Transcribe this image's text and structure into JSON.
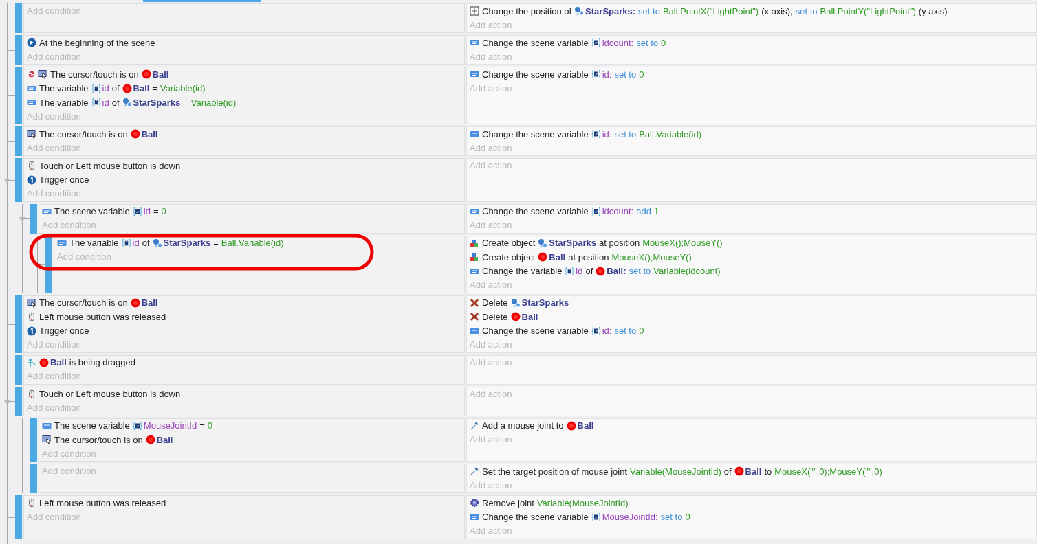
{
  "events": [
    {
      "actions": [
        {
          "kind": "position",
          "parts": [
            {
              "kind": "text",
              "text": "Change the position of"
            },
            {
              "kind": "sparks",
              "text": "StarSparks:"
            },
            {
              "kind": "op",
              "text": "set to"
            },
            {
              "kind": "value",
              "text": "Ball.PointX(\"LightPoint\")"
            },
            {
              "kind": "text",
              "text": "(x axis),"
            },
            {
              "kind": "op",
              "text": "set to"
            },
            {
              "kind": "value",
              "text": "Ball.PointY(\"LightPoint\")"
            },
            {
              "kind": "text",
              "text": "(y axis)"
            }
          ]
        }
      ],
      "add_condition": "Add condition",
      "add_action": "Add action"
    },
    {
      "conditions": [
        {
          "kind": "start",
          "parts": [
            {
              "kind": "text",
              "text": "At the beginning of the scene"
            }
          ]
        }
      ],
      "actions": [
        {
          "kind": "var",
          "parts": [
            {
              "kind": "text",
              "text": "Change the scene variable"
            },
            {
              "kind": "scenevar",
              "text": "idcount:"
            },
            {
              "kind": "op",
              "text": "set to"
            },
            {
              "kind": "value",
              "text": "0"
            }
          ]
        }
      ],
      "add_condition": "Add condition",
      "add_action": "Add action"
    },
    {
      "conditions": [
        {
          "kind": "swapcursor",
          "parts": [
            {
              "kind": "text",
              "text": "The cursor/touch is on"
            },
            {
              "kind": "ball",
              "text": "Ball"
            }
          ]
        },
        {
          "kind": "var",
          "parts": [
            {
              "kind": "text",
              "text": "The variable"
            },
            {
              "kind": "objvar",
              "text": "id"
            },
            {
              "kind": "text",
              "text": "of"
            },
            {
              "kind": "ball",
              "text": "Ball"
            },
            {
              "kind": "text",
              "text": "="
            },
            {
              "kind": "value",
              "text": "Variable(id)"
            }
          ]
        },
        {
          "kind": "var",
          "parts": [
            {
              "kind": "text",
              "text": "The variable"
            },
            {
              "kind": "objvar",
              "text": "id"
            },
            {
              "kind": "text",
              "text": "of"
            },
            {
              "kind": "sparks",
              "text": "StarSparks"
            },
            {
              "kind": "text",
              "text": "="
            },
            {
              "kind": "value",
              "text": "Variable(id)"
            }
          ]
        }
      ],
      "actions": [
        {
          "kind": "var",
          "parts": [
            {
              "kind": "text",
              "text": "Change the scene variable"
            },
            {
              "kind": "scenevar",
              "text": "id:"
            },
            {
              "kind": "op",
              "text": "set to"
            },
            {
              "kind": "value",
              "text": "0"
            }
          ]
        }
      ],
      "add_condition": "Add condition",
      "add_action": "Add action"
    },
    {
      "conditions": [
        {
          "kind": "cursor",
          "parts": [
            {
              "kind": "text",
              "text": "The cursor/touch is on"
            },
            {
              "kind": "ball",
              "text": "Ball"
            }
          ]
        }
      ],
      "actions": [
        {
          "kind": "var",
          "parts": [
            {
              "kind": "text",
              "text": "Change the scene variable"
            },
            {
              "kind": "scenevar",
              "text": "id:"
            },
            {
              "kind": "op",
              "text": "set to"
            },
            {
              "kind": "value",
              "text": "Ball.Variable(id)"
            }
          ]
        }
      ],
      "add_condition": "Add condition",
      "add_action": "Add action"
    },
    {
      "expanded": true,
      "conditions": [
        {
          "kind": "mouse",
          "parts": [
            {
              "kind": "text",
              "text": "Touch or Left mouse button is down"
            }
          ]
        },
        {
          "kind": "once",
          "parts": [
            {
              "kind": "text",
              "text": "Trigger once"
            }
          ]
        }
      ],
      "add_condition": "Add condition",
      "add_action": "Add action",
      "children": [
        {
          "expanded": true,
          "conditions": [
            {
              "kind": "var",
              "parts": [
                {
                  "kind": "text",
                  "text": "The scene variable"
                },
                {
                  "kind": "scenevar",
                  "text": "id"
                },
                {
                  "kind": "text",
                  "text": "="
                },
                {
                  "kind": "value",
                  "text": "0"
                }
              ]
            }
          ],
          "actions": [
            {
              "kind": "var",
              "parts": [
                {
                  "kind": "text",
                  "text": "Change the scene variable"
                },
                {
                  "kind": "scenevar",
                  "text": "idcount:"
                },
                {
                  "kind": "op",
                  "text": "add"
                },
                {
                  "kind": "value",
                  "text": "1"
                }
              ]
            }
          ],
          "add_condition": "Add condition",
          "add_action": "Add action",
          "children": [
            {
              "circled": true,
              "conditions": [
                {
                  "kind": "var",
                  "parts": [
                    {
                      "kind": "text",
                      "text": "The variable"
                    },
                    {
                      "kind": "objvar",
                      "text": "id"
                    },
                    {
                      "kind": "text",
                      "text": "of"
                    },
                    {
                      "kind": "sparks",
                      "text": "StarSparks"
                    },
                    {
                      "kind": "text",
                      "text": "="
                    },
                    {
                      "kind": "value",
                      "text": "Ball.Variable(id)"
                    }
                  ]
                }
              ],
              "actions": [
                {
                  "kind": "create",
                  "parts": [
                    {
                      "kind": "text",
                      "text": "Create object"
                    },
                    {
                      "kind": "sparks",
                      "text": "StarSparks"
                    },
                    {
                      "kind": "text",
                      "text": "at position"
                    },
                    {
                      "kind": "value",
                      "text": "MouseX();MouseY()"
                    }
                  ]
                },
                {
                  "kind": "create",
                  "parts": [
                    {
                      "kind": "text",
                      "text": "Create object"
                    },
                    {
                      "kind": "ball",
                      "text": "Ball"
                    },
                    {
                      "kind": "text",
                      "text": "at position"
                    },
                    {
                      "kind": "value",
                      "text": "MouseX();MouseY()"
                    }
                  ]
                },
                {
                  "kind": "var",
                  "parts": [
                    {
                      "kind": "text",
                      "text": "Change the variable"
                    },
                    {
                      "kind": "objvar",
                      "text": "id"
                    },
                    {
                      "kind": "text",
                      "text": "of"
                    },
                    {
                      "kind": "ball",
                      "text": "Ball:"
                    },
                    {
                      "kind": "op",
                      "text": "set to"
                    },
                    {
                      "kind": "value",
                      "text": "Variable(idcount)"
                    }
                  ]
                }
              ],
              "add_condition": "Add condition",
              "add_action": "Add action"
            }
          ]
        }
      ]
    },
    {
      "conditions": [
        {
          "kind": "cursor",
          "parts": [
            {
              "kind": "text",
              "text": "The cursor/touch is on"
            },
            {
              "kind": "ball",
              "text": "Ball"
            }
          ]
        },
        {
          "kind": "mouse",
          "parts": [
            {
              "kind": "text",
              "text": "Left mouse button was released"
            }
          ]
        },
        {
          "kind": "once",
          "parts": [
            {
              "kind": "text",
              "text": "Trigger once"
            }
          ]
        }
      ],
      "actions": [
        {
          "kind": "delete",
          "parts": [
            {
              "kind": "text",
              "text": "Delete"
            },
            {
              "kind": "sparks",
              "text": "StarSparks"
            }
          ]
        },
        {
          "kind": "delete",
          "parts": [
            {
              "kind": "text",
              "text": "Delete"
            },
            {
              "kind": "ball",
              "text": "Ball"
            }
          ]
        },
        {
          "kind": "var",
          "parts": [
            {
              "kind": "text",
              "text": "Change the scene variable"
            },
            {
              "kind": "scenevar",
              "text": "id:"
            },
            {
              "kind": "op",
              "text": "set to"
            },
            {
              "kind": "value",
              "text": "0"
            }
          ]
        }
      ],
      "add_condition": "Add condition",
      "add_action": "Add action"
    },
    {
      "conditions": [
        {
          "kind": "drag",
          "parts": [
            {
              "kind": "ball",
              "text": "Ball"
            },
            {
              "kind": "text",
              "text": "is being dragged"
            }
          ]
        }
      ],
      "add_condition": "Add condition",
      "add_action": "Add action"
    },
    {
      "expanded": true,
      "conditions": [
        {
          "kind": "mouse",
          "parts": [
            {
              "kind": "text",
              "text": "Touch or Left mouse button is down"
            }
          ]
        }
      ],
      "add_condition": "Add condition",
      "add_action": "Add action",
      "children": [
        {
          "conditions": [
            {
              "kind": "var",
              "parts": [
                {
                  "kind": "text",
                  "text": "The scene variable"
                },
                {
                  "kind": "scenevar",
                  "text": "MouseJointId"
                },
                {
                  "kind": "text",
                  "text": "="
                },
                {
                  "kind": "value",
                  "text": "0"
                }
              ]
            },
            {
              "kind": "cursor",
              "parts": [
                {
                  "kind": "text",
                  "text": "The cursor/touch is on"
                },
                {
                  "kind": "ball",
                  "text": "Ball"
                }
              ]
            }
          ],
          "actions": [
            {
              "kind": "joint",
              "parts": [
                {
                  "kind": "text",
                  "text": "Add a mouse joint to"
                },
                {
                  "kind": "ball",
                  "text": "Ball"
                }
              ]
            }
          ],
          "add_condition": "Add condition",
          "add_action": "Add action"
        },
        {
          "actions": [
            {
              "kind": "joint",
              "parts": [
                {
                  "kind": "text",
                  "text": "Set the target position of mouse joint"
                },
                {
                  "kind": "value",
                  "text": "Variable(MouseJointId)"
                },
                {
                  "kind": "text",
                  "text": "of"
                },
                {
                  "kind": "ball",
                  "text": "Ball"
                },
                {
                  "kind": "text",
                  "text": "to"
                },
                {
                  "kind": "value",
                  "text": "MouseX(\"\",0);MouseY(\"\",0)"
                }
              ]
            }
          ],
          "add_condition": "Add condition",
          "add_action": "Add action"
        }
      ]
    },
    {
      "conditions": [
        {
          "kind": "mouse",
          "parts": [
            {
              "kind": "text",
              "text": "Left mouse button was released"
            }
          ]
        }
      ],
      "actions": [
        {
          "kind": "gear",
          "parts": [
            {
              "kind": "text",
              "text": "Remove joint"
            },
            {
              "kind": "value",
              "text": "Variable(MouseJointId)"
            }
          ]
        },
        {
          "kind": "var",
          "parts": [
            {
              "kind": "text",
              "text": "Change the scene variable"
            },
            {
              "kind": "scenevar",
              "text": "MouseJointId:"
            },
            {
              "kind": "op",
              "text": "set to"
            },
            {
              "kind": "value",
              "text": "0"
            }
          ]
        }
      ],
      "add_condition": "Add condition",
      "add_action": "Add action"
    }
  ]
}
